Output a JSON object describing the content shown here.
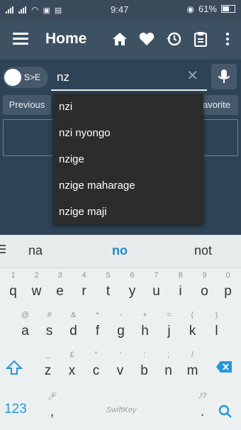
{
  "status": {
    "time": "9:47",
    "battery": "61%"
  },
  "appbar": {
    "title": "Home"
  },
  "search": {
    "toggle_label": "S>E",
    "value": "nz"
  },
  "buttons": {
    "previous": "Previous",
    "favorite": "avorite"
  },
  "dropdown": {
    "items": [
      "nzi",
      "nzi nyongo",
      "nzige",
      "nzige maharage",
      "nzige maji"
    ]
  },
  "suggestions": {
    "left": "na",
    "middle": "no",
    "right": "not"
  },
  "keyboard": {
    "row1": [
      {
        "alt": "1",
        "main": "q"
      },
      {
        "alt": "2",
        "main": "w"
      },
      {
        "alt": "3",
        "main": "e"
      },
      {
        "alt": "4",
        "main": "r"
      },
      {
        "alt": "5",
        "main": "t"
      },
      {
        "alt": "6",
        "main": "y"
      },
      {
        "alt": "7",
        "main": "u"
      },
      {
        "alt": "8",
        "main": "i"
      },
      {
        "alt": "9",
        "main": "o"
      },
      {
        "alt": "0",
        "main": "p"
      }
    ],
    "row2": [
      {
        "alt": "@",
        "main": "a"
      },
      {
        "alt": "#",
        "main": "s"
      },
      {
        "alt": "&",
        "main": "d"
      },
      {
        "alt": "*",
        "main": "f"
      },
      {
        "alt": "-",
        "main": "g"
      },
      {
        "alt": "+",
        "main": "h"
      },
      {
        "alt": "=",
        "main": "j"
      },
      {
        "alt": "(",
        "main": "k"
      },
      {
        "alt": ")",
        "main": "l"
      }
    ],
    "row3": [
      {
        "alt": "_",
        "main": "z"
      },
      {
        "alt": "£",
        "main": "x"
      },
      {
        "alt": "\"",
        "main": "c"
      },
      {
        "alt": "'",
        "main": "v"
      },
      {
        "alt": ":",
        "main": "b"
      },
      {
        "alt": ";",
        "main": "n"
      },
      {
        "alt": "/",
        "main": "m"
      }
    ],
    "numbers_label": "123",
    "comma": ",",
    "period": ".",
    "period_alt": ",!?",
    "brand": "SwiftKey"
  }
}
